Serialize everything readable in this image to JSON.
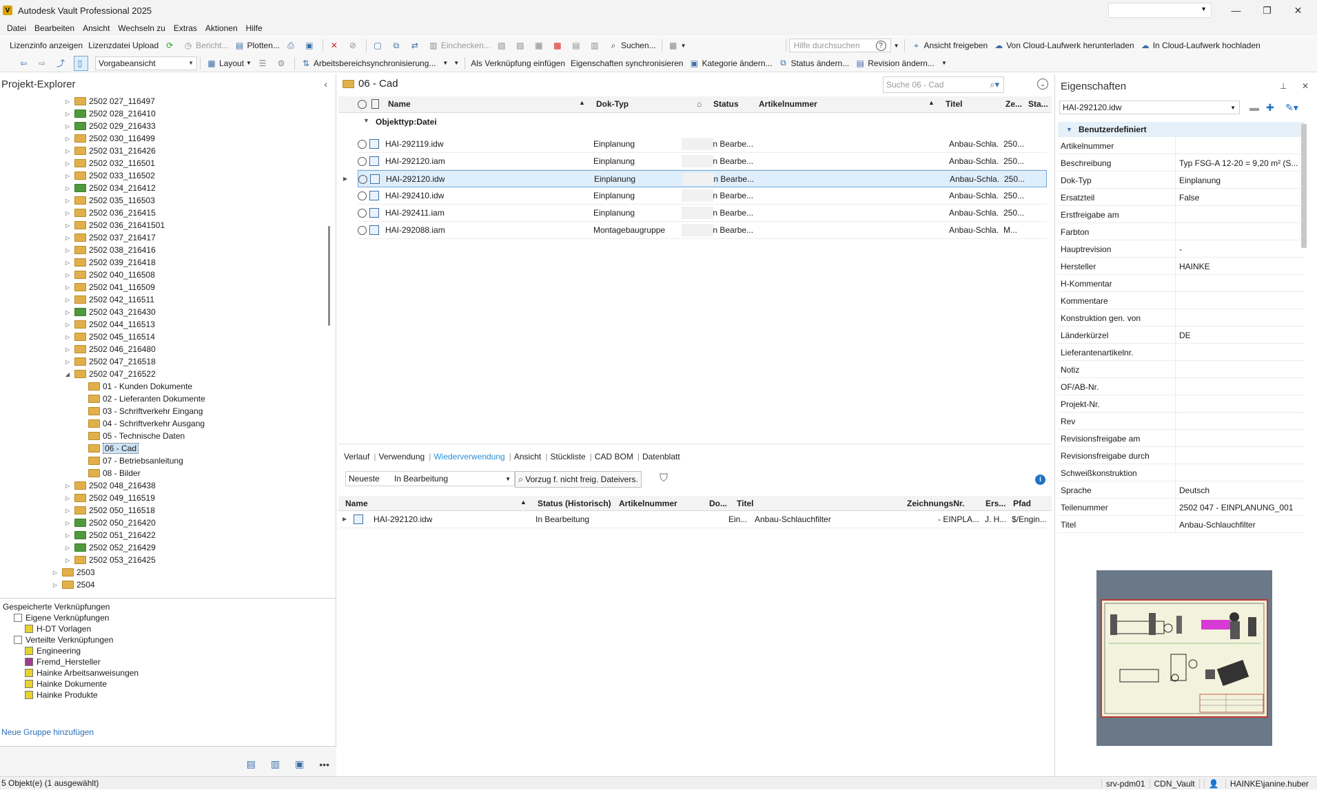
{
  "window": {
    "title": "Autodesk Vault Professional 2025",
    "app_icon": "V"
  },
  "menu": [
    "Datei",
    "Bearbeiten",
    "Ansicht",
    "Wechseln zu",
    "Extras",
    "Aktionen",
    "Hilfe"
  ],
  "toolbar1": {
    "lizenzinfo": "Lizenzinfo anzeigen",
    "lizenzdatei": "Lizenzdatei Upload",
    "bericht": "Bericht...",
    "plotten": "Plotten...",
    "einchecken": "Einchecken...",
    "suchen": "Suchen...",
    "hilfe_placeholder": "Hilfe durchsuchen",
    "ansicht_freigeben": "Ansicht freigeben",
    "cloud_download": "Von Cloud-Laufwerk herunterladen",
    "cloud_upload": "In Cloud-Laufwerk hochladen"
  },
  "toolbar2": {
    "view_combo": "Vorgabeansicht",
    "layout": "Layout",
    "arbeitsbereich": "Arbeitsbereichsynchronisierung...",
    "verknuepfung": "Als Verknüpfung einfügen",
    "eigenschaften_sync": "Eigenschaften synchronisieren",
    "kategorie": "Kategorie ändern...",
    "status": "Status ändern...",
    "revision": "Revision ändern..."
  },
  "explorer": {
    "title": "Projekt-Explorer",
    "folders": [
      {
        "label": "2502 027_116497",
        "color": "yellow"
      },
      {
        "label": "2502 028_216410",
        "color": "green"
      },
      {
        "label": "2502 029_216433",
        "color": "green"
      },
      {
        "label": "2502 030_116499",
        "color": "yellow"
      },
      {
        "label": "2502 031_216426",
        "color": "yellow"
      },
      {
        "label": "2502 032_116501",
        "color": "yellow"
      },
      {
        "label": "2502 033_116502",
        "color": "yellow"
      },
      {
        "label": "2502 034_216412",
        "color": "green"
      },
      {
        "label": "2502 035_116503",
        "color": "yellow"
      },
      {
        "label": "2502 036_216415",
        "color": "yellow"
      },
      {
        "label": "2502 036_21641501",
        "color": "yellow"
      },
      {
        "label": "2502 037_216417",
        "color": "yellow"
      },
      {
        "label": "2502 038_216416",
        "color": "yellow"
      },
      {
        "label": "2502 039_216418",
        "color": "yellow"
      },
      {
        "label": "2502 040_116508",
        "color": "yellow"
      },
      {
        "label": "2502 041_116509",
        "color": "yellow"
      },
      {
        "label": "2502 042_116511",
        "color": "yellow"
      },
      {
        "label": "2502 043_216430",
        "color": "green"
      },
      {
        "label": "2502 044_116513",
        "color": "yellow"
      },
      {
        "label": "2502 045_116514",
        "color": "yellow"
      },
      {
        "label": "2502 046_216480",
        "color": "yellow"
      },
      {
        "label": "2502 047_216518",
        "color": "yellow"
      },
      {
        "label": "2502 047_216522",
        "color": "yellow"
      }
    ],
    "subfolders": [
      "01 - Kunden Dokumente",
      "02 - Lieferanten Dokumente",
      "03 - Schriftverkehr Eingang",
      "04 - Schriftverkehr Ausgang",
      "05 - Technische Daten",
      "06 - Cad",
      "07 - Betriebsanleitung",
      "08 - Bilder"
    ],
    "folders_after": [
      {
        "label": "2502 048_216438",
        "color": "yellow"
      },
      {
        "label": "2502 049_116519",
        "color": "yellow"
      },
      {
        "label": "2502 050_116518",
        "color": "yellow"
      },
      {
        "label": "2502 050_216420",
        "color": "green"
      },
      {
        "label": "2502 051_216422",
        "color": "green"
      },
      {
        "label": "2502 052_216429",
        "color": "green"
      },
      {
        "label": "2502 053_216425",
        "color": "yellow"
      }
    ],
    "top_folders": [
      "2503",
      "2504"
    ]
  },
  "saved_links": {
    "header": "Gespeicherte Verknüpfungen",
    "own": "Eigene Verknüpfungen",
    "own_items": [
      "H-DT Vorlagen"
    ],
    "shared": "Verteilte Verknüpfungen",
    "shared_items": [
      "Engineering",
      "Fremd_Hersteller",
      "Hainke Arbeitsanweisungen",
      "Hainke Dokumente",
      "Hainke Produkte"
    ],
    "new_group": "Neue Gruppe hinzufügen"
  },
  "main": {
    "folder_title": "06 - Cad",
    "search_placeholder": "Suche 06 - Cad",
    "columns": {
      "name": "Name",
      "doktyp": "Dok-Typ",
      "status": "Status",
      "artikel": "Artikelnummer",
      "titel": "Titel",
      "ze": "Ze...",
      "sta": "Sta..."
    },
    "group_label": "Objekttyp:Datei",
    "rows": [
      {
        "name": "HAI-292119.idw",
        "doktyp": "Einplanung",
        "status": "In Bearbe...",
        "titel": "Anbau-Schla...",
        "ze": "250...",
        "selected": false
      },
      {
        "name": "HAI-292120.iam",
        "doktyp": "Einplanung",
        "status": "In Bearbe...",
        "titel": "Anbau-Schla...",
        "ze": "250...",
        "selected": false
      },
      {
        "name": "HAI-292120.idw",
        "doktyp": "Einplanung",
        "status": "In Bearbe...",
        "titel": "Anbau-Schla...",
        "ze": "250...",
        "selected": true
      },
      {
        "name": "HAI-292410.idw",
        "doktyp": "Einplanung",
        "status": "In Bearbe...",
        "titel": "Anbau-Schla...",
        "ze": "250...",
        "selected": false
      },
      {
        "name": "HAI-292411.iam",
        "doktyp": "Einplanung",
        "status": "In Bearbe...",
        "titel": "Anbau-Schla...",
        "ze": "250...",
        "selected": false
      },
      {
        "name": "HAI-292088.iam",
        "doktyp": "Montagebaugruppe",
        "status": "In Bearbe...",
        "titel": "Anbau-Schla...",
        "ze": "M...",
        "selected": false
      }
    ]
  },
  "tabs": [
    "Verlauf",
    "Verwendung",
    "Wiederverwendung",
    "Ansicht",
    "Stückliste",
    "CAD BOM",
    "Datenblatt"
  ],
  "active_tab": "Wiederverwendung",
  "lower": {
    "combo1": "Neueste",
    "combo2": "In Bearbeitung",
    "prefer_button": "Vorzug f. nicht freig. Dateivers.",
    "columns": {
      "name": "Name",
      "status": "Status (Historisch)",
      "artikel": "Artikelnummer",
      "do": "Do...",
      "titel": "Titel",
      "zeichnung": "ZeichnungsNr.",
      "ers": "Ers...",
      "pfad": "Pfad"
    },
    "row": {
      "name": "HAI-292120.idw",
      "status": "In Bearbeitung",
      "do": "Ein...",
      "titel": "Anbau-Schlauchfilter",
      "zeichnung": "- EINPLA...",
      "ers": "J. H...",
      "pfad": "$/Engin..."
    }
  },
  "properties": {
    "title": "Eigenschaften",
    "selected_file": "HAI-292120.idw",
    "group": "Benutzerdefiniert",
    "rows": [
      {
        "key": "Artikelnummer",
        "value": ""
      },
      {
        "key": "Beschreibung",
        "value": "Typ FSG-A 12-20 = 9,20 m² (S..."
      },
      {
        "key": "Dok-Typ",
        "value": "Einplanung"
      },
      {
        "key": "Ersatzteil",
        "value": "False"
      },
      {
        "key": "Erstfreigabe am",
        "value": ""
      },
      {
        "key": "Farbton",
        "value": ""
      },
      {
        "key": "Hauptrevision",
        "value": "-"
      },
      {
        "key": "Hersteller",
        "value": "HAINKE"
      },
      {
        "key": "H-Kommentar",
        "value": ""
      },
      {
        "key": "Kommentare",
        "value": ""
      },
      {
        "key": "Konstruktion gen. von",
        "value": ""
      },
      {
        "key": "Länderkürzel",
        "value": "DE"
      },
      {
        "key": "Lieferantenartikelnr.",
        "value": ""
      },
      {
        "key": "Notiz",
        "value": ""
      },
      {
        "key": "OF/AB-Nr.",
        "value": ""
      },
      {
        "key": "Projekt-Nr.",
        "value": ""
      },
      {
        "key": "Rev",
        "value": ""
      },
      {
        "key": "Revisionsfreigabe am",
        "value": ""
      },
      {
        "key": "Revisionsfreigabe durch",
        "value": ""
      },
      {
        "key": "Schweißkonstruktion",
        "value": ""
      },
      {
        "key": "Sprache",
        "value": "Deutsch"
      },
      {
        "key": "Teilenummer",
        "value": "2502 047 - EINPLANUNG_001"
      },
      {
        "key": "Titel",
        "value": "Anbau-Schlauchfilter"
      }
    ]
  },
  "status": {
    "left": "5 Objekt(e) (1 ausgewählt)",
    "server": "srv-pdm01",
    "vault": "CDN_Vault",
    "user": "HAINKE\\janine.huber"
  }
}
